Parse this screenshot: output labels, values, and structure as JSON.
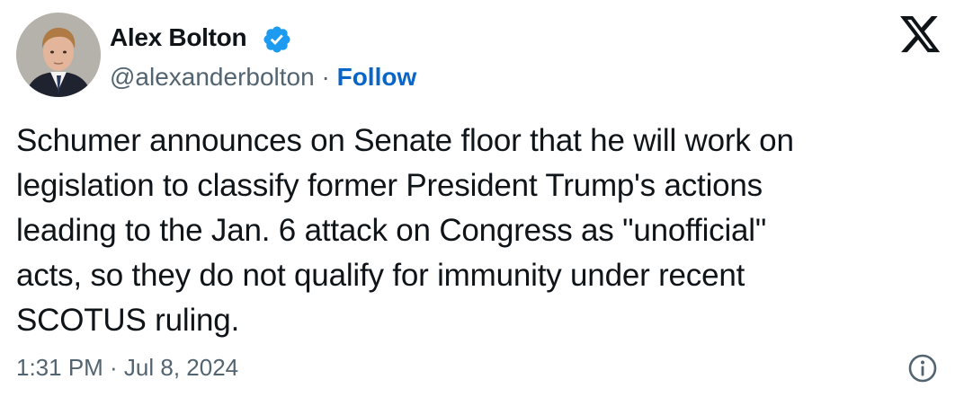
{
  "author": {
    "display_name": "Alex Bolton",
    "handle": "@alexanderbolton",
    "separator": " · ",
    "follow_label": "Follow",
    "verified": true,
    "verified_icon": "verified-badge-icon"
  },
  "platform": {
    "logo_icon": "x-logo-icon"
  },
  "tweet": {
    "text": "Schumer announces on Senate floor that he will work on\nlegislation to classify former President Trump's actions\nleading to the Jan. 6 attack on Congress as \"unofficial\"\nacts, so they do not qualify for immunity under recent\nSCOTUS ruling.",
    "timestamp": "1:31 PM · Jul 8, 2024"
  },
  "footer": {
    "info_icon": "info-icon"
  },
  "colors": {
    "text": "#0f1419",
    "secondary": "#536471",
    "follow": "#0a65c8",
    "verified": "#1d9bf0"
  }
}
